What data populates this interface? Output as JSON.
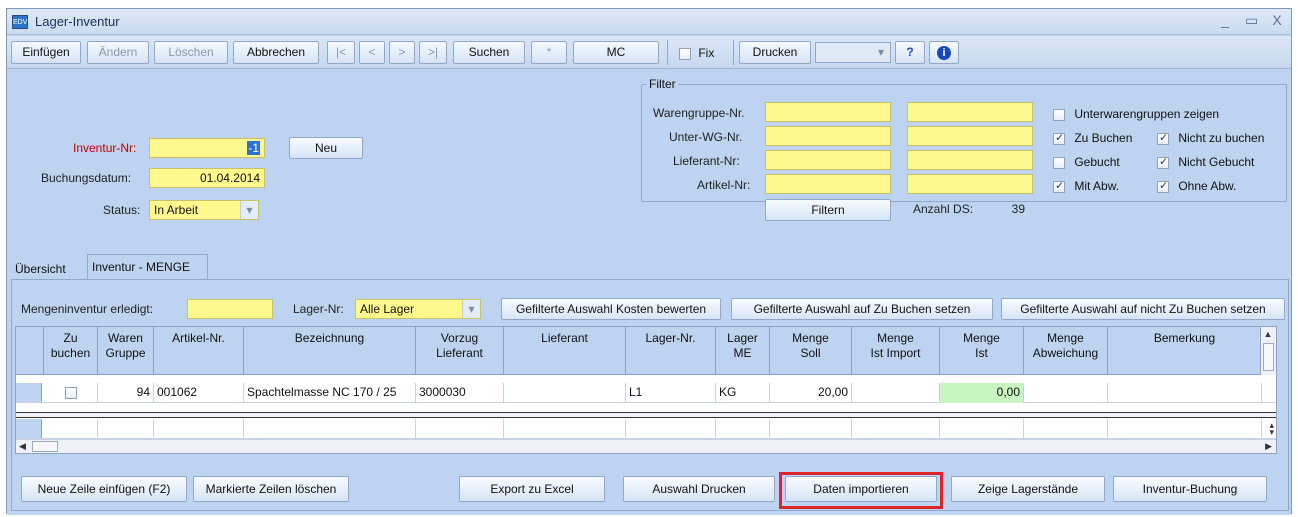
{
  "window": {
    "title": "Lager-Inventur",
    "icon_text": "EDV",
    "controls": [
      "_",
      "▭",
      "X"
    ]
  },
  "toolbar": {
    "einfuegen": "Einfügen",
    "aendern": "Ändern",
    "loeschen": "Löschen",
    "abbrechen": "Abbrechen",
    "nav_first": "|<",
    "nav_prev": "<",
    "nav_next": ">",
    "nav_last": ">|",
    "suchen": "Suchen",
    "star": "*",
    "mc": "MC",
    "fix": "Fix",
    "drucken": "Drucken",
    "combo_arrow": "▾",
    "help": "?",
    "info": "i"
  },
  "header": {
    "inventur_nr_label": "Inventur-Nr:",
    "inventur_nr_value": "-1",
    "neu": "Neu",
    "buchungsdatum_label": "Buchungsdatum:",
    "buchungsdatum_value": "01.04.2014",
    "status_label": "Status:",
    "status_value": "In Arbeit"
  },
  "filter": {
    "title": "Filter",
    "warengruppe_label": "Warengruppe-Nr.",
    "unterwg_label": "Unter-WG-Nr.",
    "lieferant_label": "Lieferant-Nr:",
    "artikel_label": "Artikel-Nr:",
    "filtern": "Filtern",
    "anzahl_label": "Anzahl DS:",
    "anzahl_value": "39",
    "checks": {
      "unterwarengruppen": {
        "label": "Unterwarengruppen zeigen",
        "checked": false
      },
      "zu_buchen": {
        "label": "Zu Buchen",
        "checked": true
      },
      "nicht_zu_buchen": {
        "label": "Nicht zu buchen",
        "checked": true
      },
      "gebucht": {
        "label": "Gebucht",
        "checked": false
      },
      "nicht_gebucht": {
        "label": "Nicht Gebucht",
        "checked": true
      },
      "mit_abw": {
        "label": "Mit Abw.",
        "checked": true
      },
      "ohne_abw": {
        "label": "Ohne Abw.",
        "checked": true
      }
    }
  },
  "tabs": {
    "uebersicht": "Übersicht",
    "inventur_menge": "Inventur - MENGE"
  },
  "menge_panel": {
    "erledigt_label": "Mengeninventur erledigt:",
    "lager_label": "Lager-Nr:",
    "lager_value": "Alle Lager",
    "btn_kosten": "Gefilterte Auswahl Kosten bewerten",
    "btn_zu_buchen": "Gefilterte Auswahl auf Zu Buchen setzen",
    "btn_nicht_zu_buchen": "Gefilterte Auswahl auf nicht Zu Buchen setzen"
  },
  "grid": {
    "columns": [
      {
        "line1": "Zu",
        "line2": "buchen"
      },
      {
        "line1": "Waren",
        "line2": "Gruppe"
      },
      {
        "line1": "Artikel-Nr.",
        "line2": ""
      },
      {
        "line1": "Bezeichnung",
        "line2": ""
      },
      {
        "line1": "Vorzug",
        "line2": "Lieferant"
      },
      {
        "line1": "Lieferant",
        "line2": ""
      },
      {
        "line1": "Lager-Nr.",
        "line2": ""
      },
      {
        "line1": "Lager",
        "line2": "ME"
      },
      {
        "line1": "Menge",
        "line2": "Soll"
      },
      {
        "line1": "Menge",
        "line2": "Ist Import"
      },
      {
        "line1": "Menge",
        "line2": "Ist"
      },
      {
        "line1": "Menge",
        "line2": "Abweichung"
      },
      {
        "line1": "Bemerkung",
        "line2": ""
      }
    ],
    "rows": [
      {
        "zu_buchen": false,
        "waren_gruppe": "94",
        "artikel_nr": "001062",
        "bezeichnung": "Spachtelmasse NC 170 / 25",
        "vorzug_lieferant": "3000030",
        "lieferant": "",
        "lager_nr": "L1",
        "lager_me": "KG",
        "menge_soll": "20,00",
        "menge_ist_import": "",
        "menge_ist": "0,00",
        "menge_abweichung": "",
        "bemerkung": ""
      }
    ]
  },
  "bottom": {
    "neue_zeile": "Neue Zeile einfügen (F2)",
    "markierte_loeschen": "Markierte Zeilen löschen",
    "export_excel": "Export zu Excel",
    "auswahl_drucken": "Auswahl Drucken",
    "daten_importieren": "Daten importieren",
    "zeige_lagerstaende": "Zeige Lagerstände",
    "inventur_buchung": "Inventur-Buchung"
  },
  "colors": {
    "window_bg": "#bdd3ef",
    "field_yellow": "#fff98d",
    "menge_ist_green": "#c9f5c0",
    "highlight_red": "#e0222a"
  }
}
